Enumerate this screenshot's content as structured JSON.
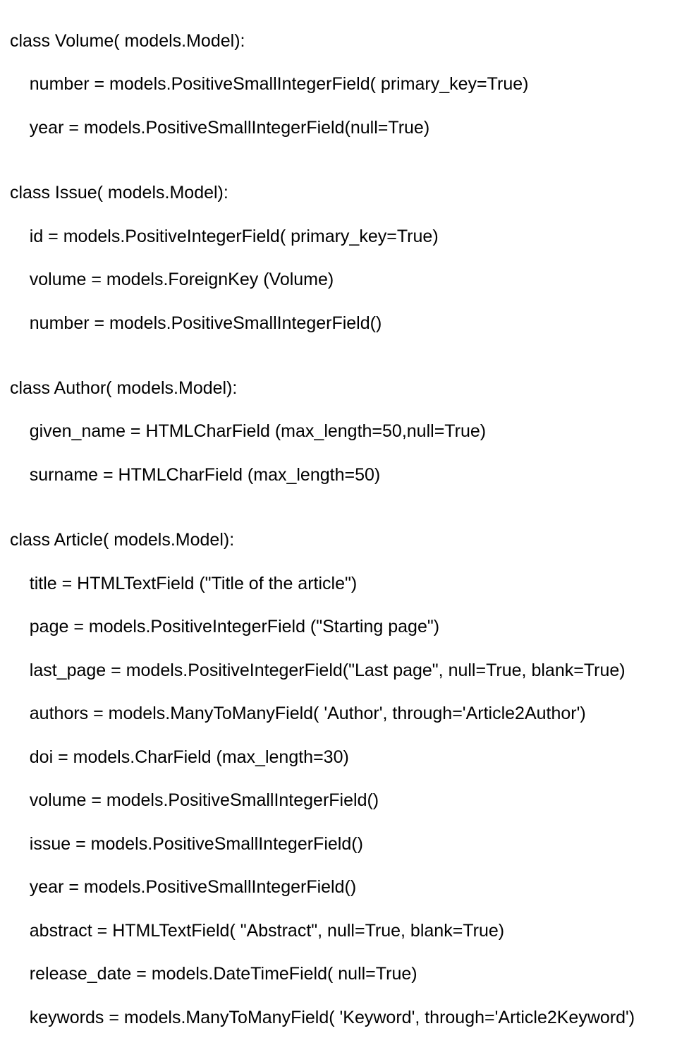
{
  "code": {
    "lines": [
      "class Volume( models.Model):",
      "    number = models.PositiveSmallIntegerField( primary_key=True)",
      "    year = models.PositiveSmallIntegerField(null=True)",
      "",
      "class Issue( models.Model):",
      "    id = models.PositiveIntegerField( primary_key=True)",
      "    volume = models.ForeignKey (Volume)",
      "    number = models.PositiveSmallIntegerField()",
      "",
      "class Author( models.Model):",
      "    given_name = HTMLCharField (max_length=50,null=True)",
      "    surname = HTMLCharField (max_length=50)",
      "",
      "class Article( models.Model):",
      "    title = HTMLTextField (\"Title of the article\")",
      "    page = models.PositiveIntegerField (\"Starting page\")",
      "    last_page = models.PositiveIntegerField(\"Last page\", null=True, blank=True)",
      "    authors = models.ManyToManyField( 'Author', through='Article2Author')",
      "    doi = models.CharField (max_length=30)",
      "    volume = models.PositiveSmallIntegerField()",
      "    issue = models.PositiveSmallIntegerField()",
      "    year = models.PositiveSmallIntegerField()",
      "    abstract = HTMLTextField( \"Abstract\", null=True, blank=True)",
      "    release_date = models.DateTimeField( null=True)",
      "    keywords = models.ManyToManyField( 'Keyword', through='Article2Keyword')"
    ]
  }
}
